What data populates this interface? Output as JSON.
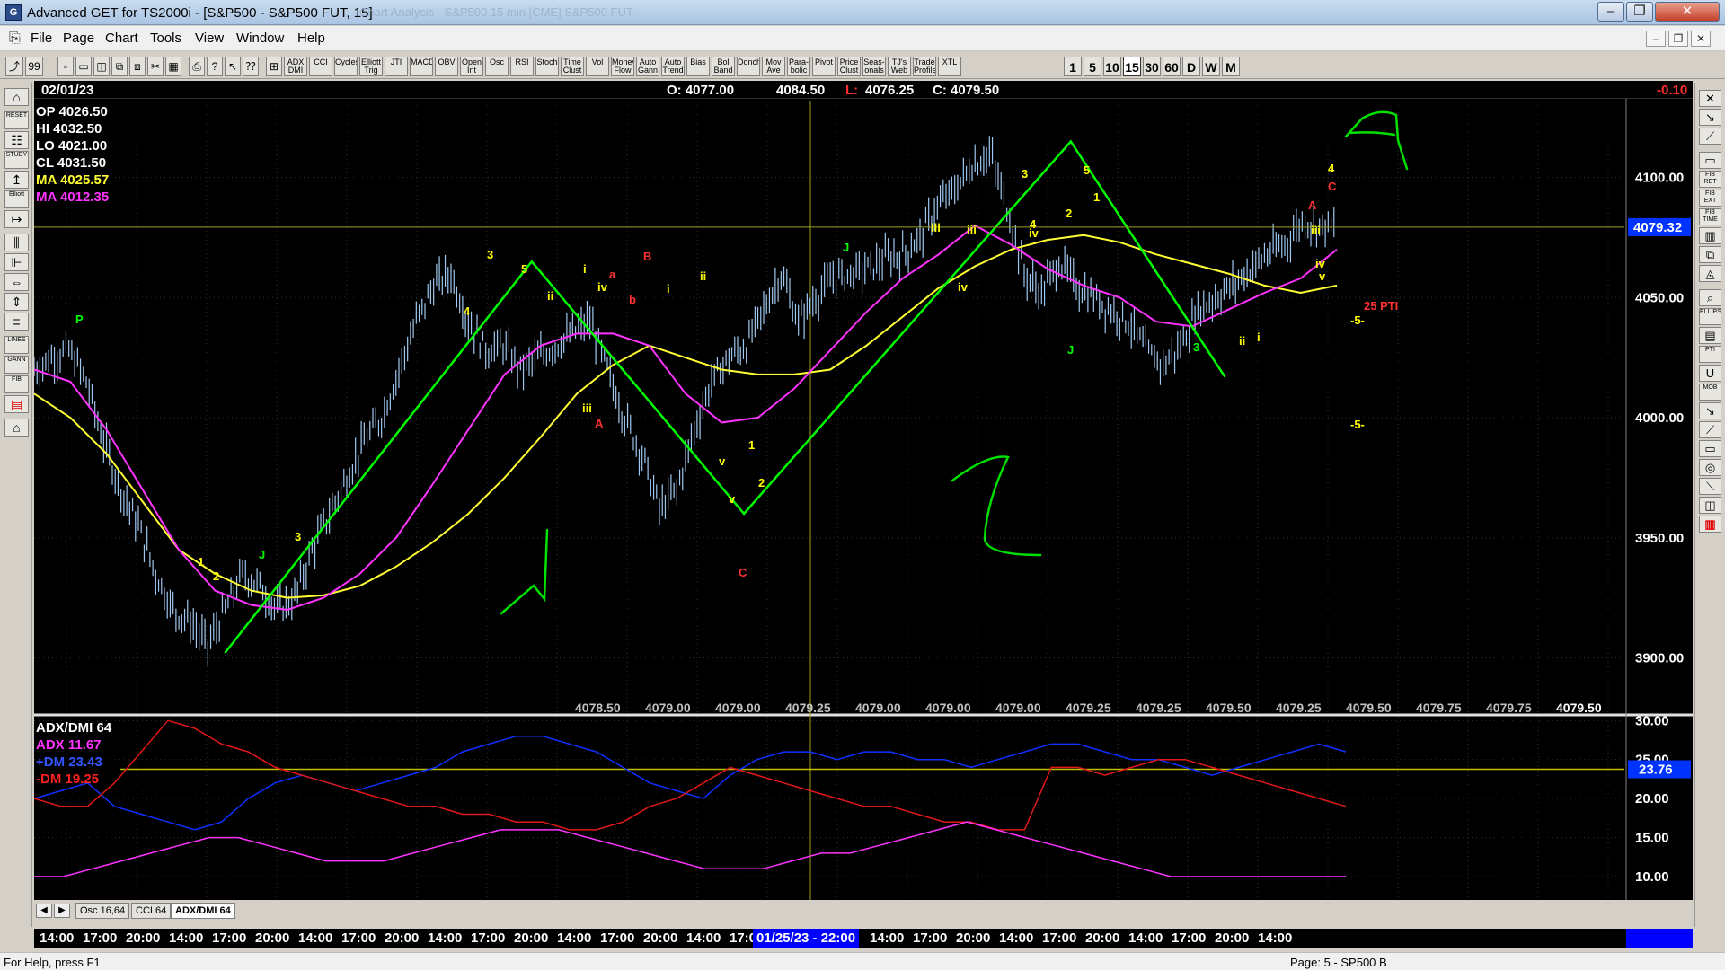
{
  "window": {
    "title": "Advanced GET for TS2000i - [S&P500 - S&P500 FUT, 15]",
    "ghost_title": "Chart Analysis - S&P500 15 min  [CME] S&P500 FUT"
  },
  "menu": [
    "File",
    "Page",
    "Chart",
    "Tools",
    "View",
    "Window",
    "Help"
  ],
  "toolbar": {
    "buttons": [
      "ADX DMI",
      "CCI",
      "Cycles",
      "Elliott Trig",
      "JTI",
      "MACD",
      "OBV",
      "Open Int",
      "Osc",
      "RSI",
      "Stoch",
      "Time Clust",
      "Vol",
      "Money Flow",
      "Auto Gann",
      "Auto Trend",
      "Bias",
      "Bol Band",
      "Donch",
      "Mov Ave",
      "Para-bolic",
      "Pivot",
      "Price Clust",
      "Seas-onals",
      "TJ's Web",
      "Trade Profile",
      "XTL"
    ],
    "intervals": [
      "1",
      "5",
      "10",
      "15",
      "30",
      "60",
      "D",
      "W",
      "M"
    ],
    "active_interval": "15"
  },
  "left_tools": [
    "RESET",
    "STUDY",
    "Elliott",
    "LINES",
    "GANN",
    "FIB"
  ],
  "right_tools": [
    "FIB RET",
    "FIB EXT",
    "FIB TIME",
    "ELLIPS",
    "PTI",
    "MOB"
  ],
  "info_bar": {
    "date": "02/01/23",
    "open": "O: 4077.00",
    "high": "4084.50",
    "low_label": "L:",
    "low": "4076.25",
    "close": "C: 4079.50",
    "change": "-0.10"
  },
  "price_readout": {
    "op": "OP  4026.50",
    "hi": "HI   4032.50",
    "lo": "LO   4021.00",
    "cl": "CL   4031.50",
    "ma1": "MA  4025.57",
    "ma2": "MA  4012.35"
  },
  "colors": {
    "up_green": "#00ff00",
    "wave_yellow": "#ffff00",
    "label_red": "#ff2020",
    "ma_yellow": "#ffff33",
    "ma_magenta": "#ff33ff",
    "price_blue": "#0033ff",
    "bars": "#9fc8f0"
  },
  "chart_data": {
    "type": "line",
    "price_axis": {
      "ticks": [
        "4100.00",
        "4050.00",
        "4000.00",
        "3950.00",
        "3900.00"
      ],
      "tick_values": [
        4100,
        4050,
        4000,
        3950,
        3900
      ],
      "ylim": [
        3877,
        4132
      ],
      "last_price": "4079.32"
    },
    "bottom_values": [
      "4078.50",
      "4079.00",
      "4079.00",
      "4079.25",
      "4079.00",
      "4079.00",
      "4079.00",
      "4079.25",
      "4079.25",
      "4079.50",
      "4079.25",
      "4079.50",
      "4079.75",
      "4079.75",
      "4079.50"
    ],
    "close_path": [
      4020,
      4025,
      4028,
      4015,
      3990,
      3970,
      3955,
      3935,
      3920,
      3915,
      3905,
      3920,
      3935,
      3930,
      3920,
      3925,
      3945,
      3960,
      3975,
      3990,
      4000,
      4020,
      4040,
      4055,
      4060,
      4040,
      4028,
      4030,
      4020,
      4025,
      4030,
      4035,
      4040,
      4020,
      4000,
      3985,
      3962,
      3970,
      3995,
      4015,
      4025,
      4030,
      4045,
      4060,
      4040,
      4050,
      4058,
      4060,
      4062,
      4066,
      4068,
      4075,
      4088,
      4095,
      4105,
      4110,
      4088,
      4060,
      4052,
      4065,
      4055,
      4050,
      4045,
      4040,
      4028,
      4022,
      4030,
      4045,
      4050,
      4055,
      4062,
      4068,
      4072,
      4082,
      4080,
      4079
    ],
    "ma_yellow_path": [
      4010,
      4000,
      3985,
      3965,
      3945,
      3935,
      3928,
      3925,
      3926,
      3930,
      3938,
      3948,
      3960,
      3975,
      3992,
      4010,
      4022,
      4030,
      4025,
      4020,
      4018,
      4018,
      4020,
      4030,
      4042,
      4054,
      4063,
      4070,
      4074,
      4076,
      4073,
      4068,
      4064,
      4060,
      4055,
      4052,
      4055
    ],
    "ma_magenta_path": [
      4020,
      4015,
      3995,
      3970,
      3945,
      3928,
      3922,
      3920,
      3925,
      3935,
      3950,
      3972,
      3995,
      4018,
      4030,
      4035,
      4035,
      4030,
      4010,
      3998,
      4000,
      4012,
      4028,
      4044,
      4058,
      4068,
      4080,
      4072,
      4062,
      4055,
      4050,
      4040,
      4038,
      4045,
      4052,
      4058,
      4070
    ],
    "green_waves": [
      {
        "x": 0.115,
        "y": 3902
      },
      {
        "x": 0.3,
        "y": 4065
      },
      {
        "x": 0.428,
        "y": 3960
      },
      {
        "x": 0.625,
        "y": 4115
      },
      {
        "x": 0.718,
        "y": 4017
      }
    ],
    "wave_labels": [
      "P",
      "1",
      "2",
      "3",
      "3",
      "4",
      "5",
      "ii",
      "iv",
      "i",
      "a",
      "b",
      "B",
      "C",
      "A",
      "iii",
      "v",
      "J",
      "i",
      "ii",
      "iv",
      "iii",
      "v",
      "1",
      "2",
      "J",
      "iii",
      "iv",
      "3",
      "4",
      "5",
      "1",
      "2",
      "J",
      "3",
      "ii",
      "i",
      "A",
      "C",
      "4",
      "iii",
      "iv",
      "v",
      "25 PTI",
      "-5-",
      "-5-"
    ],
    "indicator": {
      "name": "ADX/DMI 64",
      "adx": "ADX 11.67",
      "plus_dm": "+DM 23.43",
      "minus_dm": "-DM  19.25",
      "level": "23.76",
      "ticks": [
        "30.00",
        "25.00",
        "20.00",
        "15.00",
        "10.00"
      ],
      "tick_values": [
        30,
        25,
        20,
        15,
        10
      ],
      "ylim": [
        7,
        30.5
      ],
      "plus_dm_path": [
        20,
        21,
        22,
        19,
        18,
        17,
        16,
        17,
        20,
        22,
        23,
        22,
        21,
        22,
        23,
        24,
        26,
        27,
        28,
        28,
        27,
        26,
        24,
        22,
        21,
        20,
        23,
        25,
        26,
        26,
        25,
        26,
        26,
        25,
        25,
        24,
        25,
        26,
        27,
        27,
        26,
        25,
        25,
        24,
        23,
        24,
        25,
        26,
        27,
        26
      ],
      "minus_dm_path": [
        20,
        19,
        19,
        22,
        26,
        30,
        29,
        27,
        26,
        24,
        23,
        22,
        21,
        20,
        19,
        19,
        18,
        18,
        17,
        17,
        16,
        16,
        17,
        19,
        20,
        22,
        24,
        23,
        22,
        21,
        20,
        19,
        19,
        18,
        17,
        17,
        16,
        16,
        24,
        24,
        23,
        24,
        25,
        25,
        24,
        23,
        22,
        21,
        20,
        19
      ],
      "adx_path": [
        10,
        10,
        11,
        12,
        13,
        14,
        15,
        15,
        14,
        13,
        12,
        12,
        12,
        13,
        14,
        15,
        16,
        16,
        16,
        15,
        14,
        13,
        12,
        11,
        11,
        11,
        12,
        13,
        13,
        14,
        15,
        16,
        17,
        16,
        15,
        14,
        13,
        12,
        11,
        10,
        10,
        10,
        10,
        10,
        10,
        10
      ]
    }
  },
  "tabs": [
    "Osc 16,64",
    "CCI 64",
    "ADX/DMI 64"
  ],
  "active_tab": "ADX/DMI 64",
  "time_axis": [
    "14:00",
    "17:00",
    "20:00",
    "14:00",
    "17:00",
    "20:00",
    "14:00",
    "17:00",
    "20:00",
    "14:00",
    "17:00",
    "20:00",
    "14:00",
    "17:00",
    "20:00",
    "14:00",
    "17:00",
    "20:00",
    "14:00",
    "17:00",
    "20:00",
    "14:00",
    "17:00",
    "20:00",
    "14:00",
    "17:00",
    "20:00",
    "14:00"
  ],
  "time_cursor": "01/25/23 - 22:00",
  "status": {
    "help": "For Help, press F1",
    "page": "Page: 5 - SP500 B"
  }
}
